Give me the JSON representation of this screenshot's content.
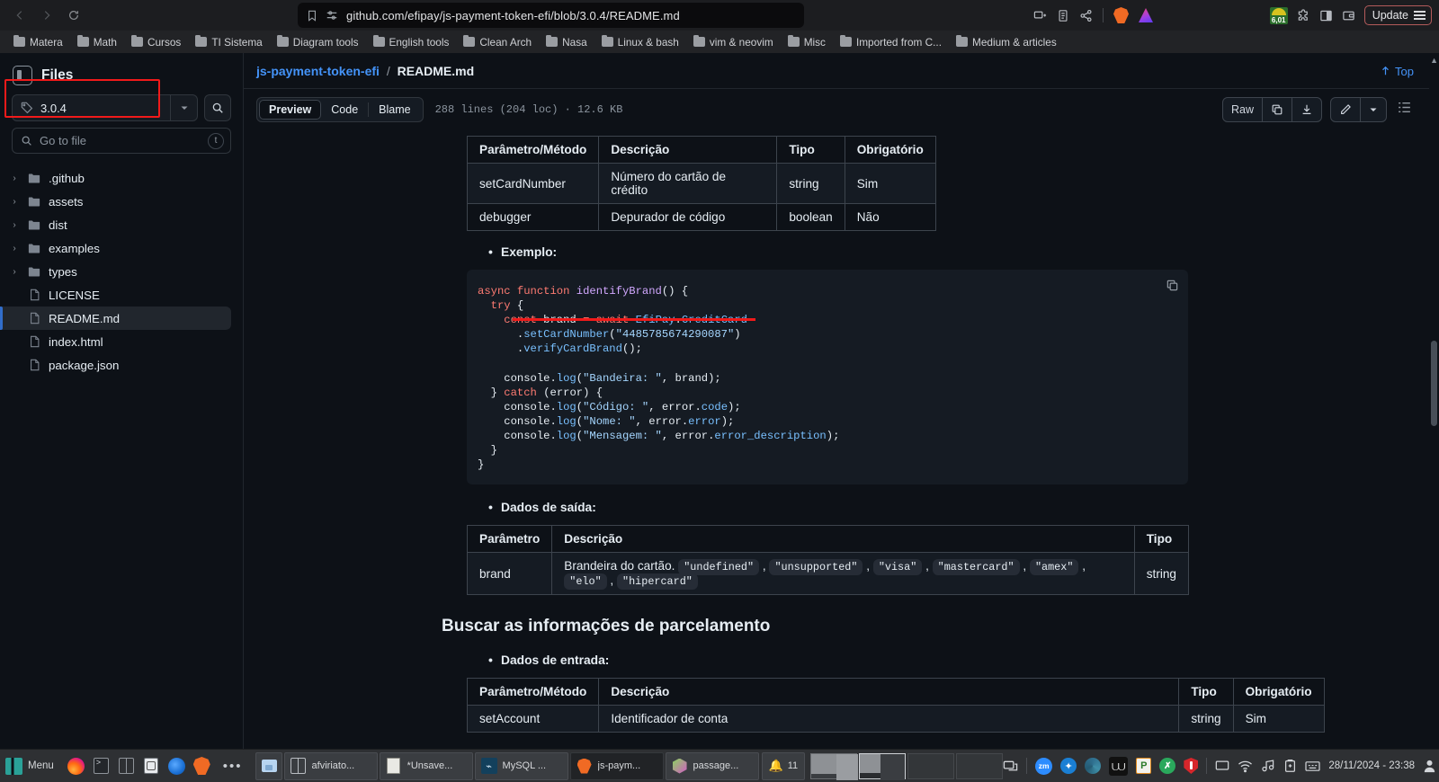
{
  "browser": {
    "url": "github.com/efipay/js-payment-token-efi/blob/3.0.4/README.md",
    "back_label": "Back",
    "forward_label": "Forward",
    "reload_label": "Reload",
    "update_label": "Update",
    "battery_value": "6,01",
    "bookmarks": [
      {
        "label": "Matera"
      },
      {
        "label": "Math"
      },
      {
        "label": "Cursos"
      },
      {
        "label": "TI Sistema"
      },
      {
        "label": "Diagram tools"
      },
      {
        "label": "English tools"
      },
      {
        "label": "Clean Arch"
      },
      {
        "label": "Nasa"
      },
      {
        "label": "Linux & bash"
      },
      {
        "label": "vim & neovim"
      },
      {
        "label": "Misc"
      },
      {
        "label": "Imported from C..."
      },
      {
        "label": "Medium & articles"
      }
    ]
  },
  "sidebar": {
    "title": "Files",
    "ref_name": "3.0.4",
    "search_placeholder": "Go to file",
    "search_kbd": "t",
    "tree": [
      {
        "label": ".github",
        "type": "folder"
      },
      {
        "label": "assets",
        "type": "folder"
      },
      {
        "label": "dist",
        "type": "folder"
      },
      {
        "label": "examples",
        "type": "folder"
      },
      {
        "label": "types",
        "type": "folder"
      },
      {
        "label": "LICENSE",
        "type": "file"
      },
      {
        "label": "README.md",
        "type": "file",
        "active": true
      },
      {
        "label": "index.html",
        "type": "file"
      },
      {
        "label": "package.json",
        "type": "file"
      }
    ]
  },
  "file_header": {
    "repo": "js-payment-token-efi",
    "separator": "/",
    "filename": "README.md",
    "top_label": "Top"
  },
  "viewbar": {
    "tabs": [
      {
        "label": "Preview",
        "selected": true
      },
      {
        "label": "Code",
        "selected": false
      },
      {
        "label": "Blame",
        "selected": false
      }
    ],
    "meta": "288 lines (204 loc) · 12.6 KB",
    "raw_label": "Raw"
  },
  "content": {
    "table_top": {
      "headers": [
        "Parâmetro/Método",
        "Descrição",
        "Tipo",
        "Obrigatório"
      ],
      "rows": [
        [
          "setCardNumber",
          "Número do cartão de crédito",
          "string",
          "Sim"
        ],
        [
          "debugger",
          "Depurador de código",
          "boolean",
          "Não"
        ]
      ]
    },
    "bullet_exemplo": "Exemplo:",
    "code": "async function identifyBrand() {\n  try {\n    const brand = await EfiPay.CreditCard\n      .setCardNumber(\"4485785674290087\")\n      .verifyCardBrand();\n\n    console.log(\"Bandeira: \", brand);\n  } catch (error) {\n    console.log(\"Código: \", error.code);\n    console.log(\"Nome: \", error.error);\n    console.log(\"Mensagem: \", error.error_description);\n  }\n}",
    "bullet_saida": "Dados de saída:",
    "table_out": {
      "headers": [
        "Parâmetro",
        "Descrição",
        "Tipo"
      ],
      "row_param": "brand",
      "row_desc_prefix": "Brandeira do cartão.",
      "row_desc_codes": [
        "\"undefined\"",
        "\"unsupported\"",
        "\"visa\"",
        "\"mastercard\"",
        "\"amex\"",
        "\"elo\"",
        "\"hipercard\""
      ],
      "row_type": "string"
    },
    "heading": "Buscar as informações de parcelamento",
    "bullet_entrada": "Dados de entrada:",
    "table_bottom": {
      "headers": [
        "Parâmetro/Método",
        "Descrição",
        "Tipo",
        "Obrigatório"
      ],
      "rows": [
        [
          "setAccount",
          "Identificador de conta",
          "string",
          "Sim"
        ]
      ]
    }
  },
  "taskbar": {
    "menu_label": "Menu",
    "tasks": [
      {
        "label": "afviriato...",
        "icon": "tiles-icon"
      },
      {
        "label": "*Unsave...",
        "icon": "note-icon"
      },
      {
        "label": "MySQL ...",
        "icon": "mysql-icon"
      },
      {
        "label": "js-paym...",
        "icon": "brave-icon"
      },
      {
        "label": "passage...",
        "icon": "cube-icon"
      }
    ],
    "notification_count": "11",
    "clock": "28/11/2024 - 23:38"
  },
  "colors": {
    "accent_blue": "#4493f8",
    "annotation_red": "#f11a1a",
    "bg": "#0d1117",
    "panel": "#151b23"
  }
}
